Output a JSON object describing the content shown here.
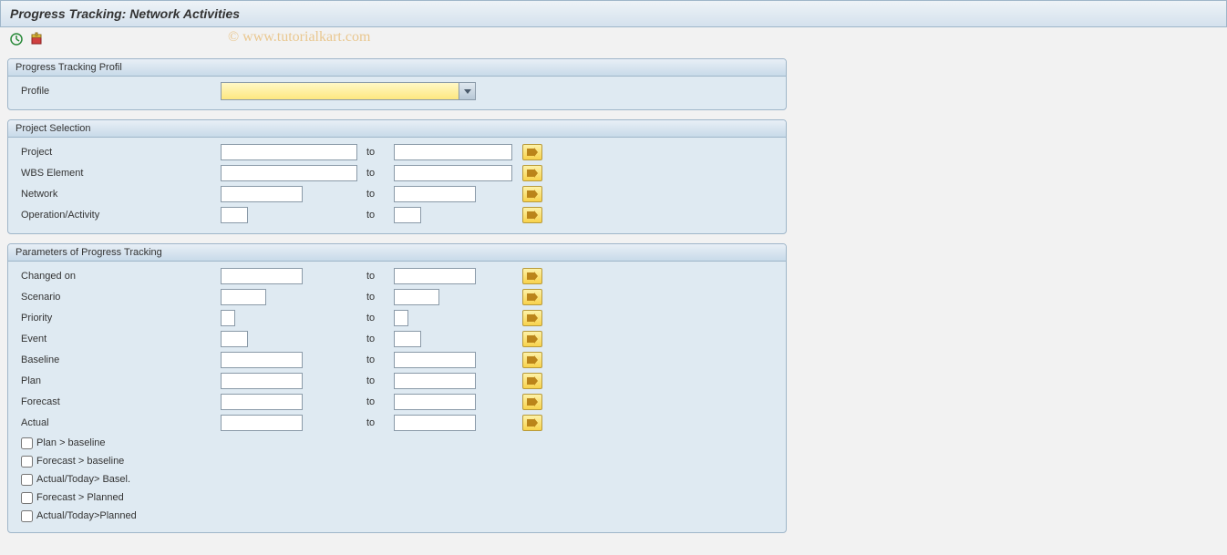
{
  "header": {
    "title": "Progress Tracking: Network Activities"
  },
  "watermark": "© www.tutorialkart.com",
  "toolbar": {
    "execute_icon": "execute",
    "variant_icon": "variant"
  },
  "groups": {
    "profile": {
      "title": "Progress Tracking Profil",
      "profile_label": "Profile",
      "profile_value": ""
    },
    "project": {
      "title": "Project Selection",
      "to_label": "to",
      "rows": {
        "project": {
          "label": "Project",
          "from": "",
          "to": ""
        },
        "wbs": {
          "label": "WBS Element",
          "from": "",
          "to": ""
        },
        "network": {
          "label": "Network",
          "from": "",
          "to": ""
        },
        "operation": {
          "label": "Operation/Activity",
          "from": "",
          "to": ""
        }
      }
    },
    "params": {
      "title": "Parameters of Progress Tracking",
      "to_label": "to",
      "rows": {
        "changed": {
          "label": "Changed on",
          "from": "",
          "to": ""
        },
        "scenario": {
          "label": "Scenario",
          "from": "",
          "to": ""
        },
        "priority": {
          "label": "Priority",
          "from": "",
          "to": ""
        },
        "event": {
          "label": "Event",
          "from": "",
          "to": ""
        },
        "baseline": {
          "label": "Baseline",
          "from": "",
          "to": ""
        },
        "plan": {
          "label": "Plan",
          "from": "",
          "to": ""
        },
        "forecast": {
          "label": "Forecast",
          "from": "",
          "to": ""
        },
        "actual": {
          "label": "Actual",
          "from": "",
          "to": ""
        }
      },
      "checks": {
        "c1": "Plan > baseline",
        "c2": "Forecast > baseline",
        "c3": "Actual/Today> Basel.",
        "c4": "Forecast > Planned",
        "c5": "Actual/Today>Planned"
      }
    }
  }
}
